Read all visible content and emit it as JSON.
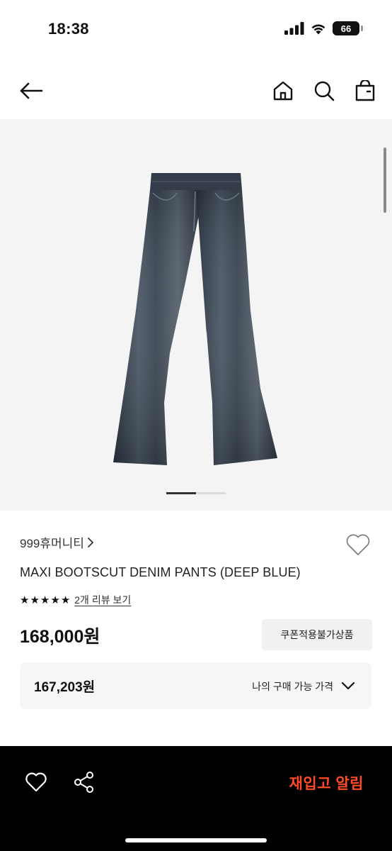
{
  "status_bar": {
    "time": "18:38",
    "battery": "66"
  },
  "nav": {
    "back_icon": "arrow-left-icon",
    "home_icon": "home-icon",
    "search_icon": "search-icon",
    "bag_icon": "shopping-bag-icon"
  },
  "gallery": {
    "total_slides": 2,
    "active_slide": 1
  },
  "product": {
    "brand": "999휴머니티",
    "name": "MAXI BOOTSCUT DENIM PANTS (DEEP BLUE)",
    "rating_stars": 5,
    "review_link": "2개 리뷰 보기",
    "price": "168,000원",
    "coupon_label": "쿠폰적용불가상품",
    "my_price": "167,203원",
    "my_price_label": "나의 구매 가능 가격"
  },
  "bottom_bar": {
    "restock_label": "재입고 알림",
    "accent_color": "#ff4a26"
  }
}
